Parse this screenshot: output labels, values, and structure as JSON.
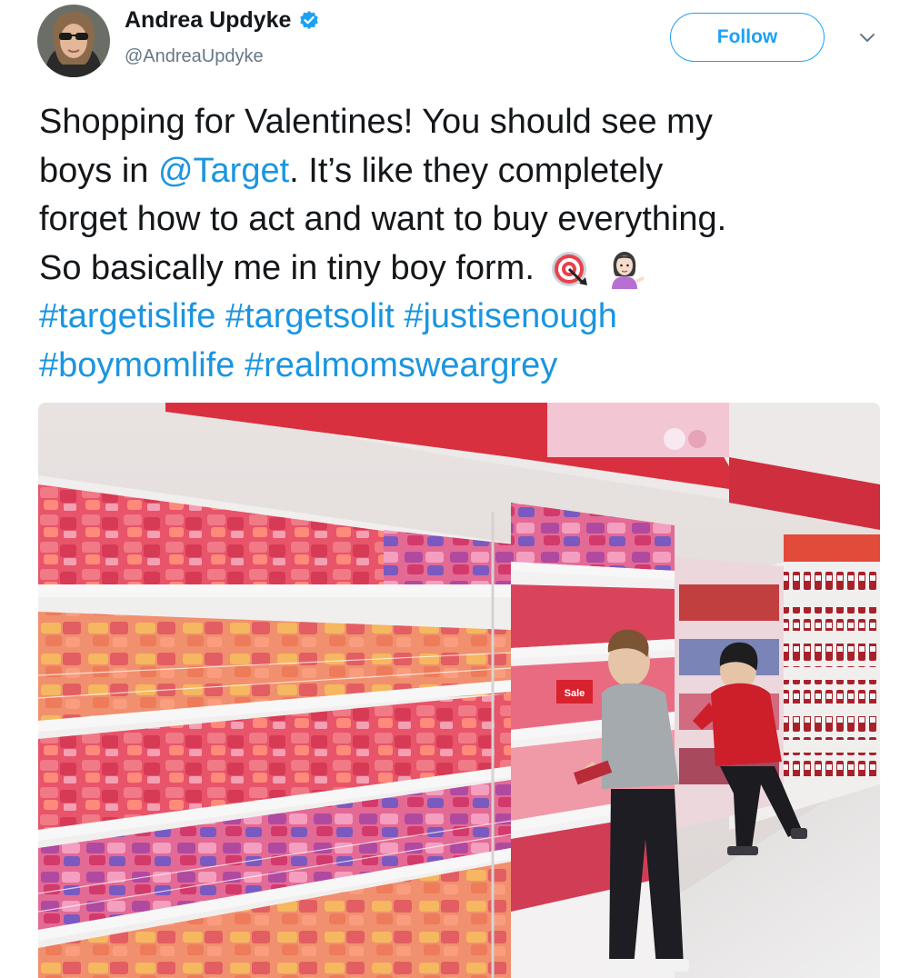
{
  "author": {
    "name": "Andrea Updyke",
    "handle": "@AndreaUpdyke",
    "verified": true
  },
  "follow_label": "Follow",
  "tweet": {
    "lines": [
      [
        {
          "text": "Shopping for Valentines! You should see my",
          "link": false
        }
      ],
      [
        {
          "text": "boys in ",
          "link": false
        },
        {
          "text": "@Target",
          "link": true
        },
        {
          "text": ". It’s like they completely",
          "link": false
        }
      ],
      [
        {
          "text": "forget how to act and want to buy everything.",
          "link": false
        }
      ],
      [
        {
          "text": "So basically me in tiny boy form.",
          "link": false
        }
      ],
      [
        {
          "text": "#targetislife #targetsolit #justisenough",
          "link": true
        }
      ],
      [
        {
          "text": "#boymomlife #realmomsweargrey",
          "link": true
        }
      ]
    ],
    "emojis": [
      "direct-hit-emoji",
      "woman-tipping-hand-emoji"
    ]
  },
  "photo": {
    "description_icon": "store-aisle-photo",
    "sign_text": "Sale"
  },
  "colors": {
    "link": "#1b95e0",
    "follow": "#1da1f2",
    "verified": "#1da1f2",
    "handle": "#657786"
  }
}
